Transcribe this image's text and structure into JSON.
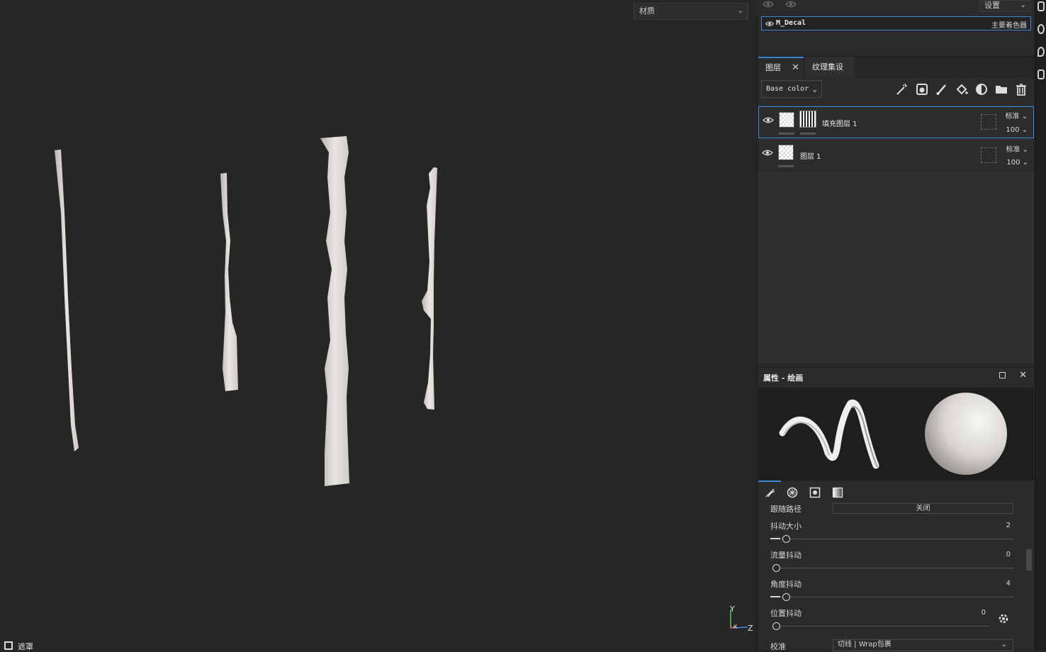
{
  "viewport": {
    "material_dropdown": "材质",
    "mask_toggle": "遮罩",
    "axis_labels": {
      "y": "Y",
      "x": "X",
      "z": "Z"
    }
  },
  "shader": {
    "settings_dropdown": "设置",
    "name": "M_Decal",
    "tag": "主要着色器"
  },
  "tabs": [
    {
      "label": "图层"
    },
    {
      "label": "纹理集设置"
    }
  ],
  "layers_toolbar": {
    "channel": "Base color"
  },
  "layers": [
    {
      "name": "填充图层 1",
      "blend": "标准",
      "opacity": "100"
    },
    {
      "name": "图层 1",
      "blend": "标准",
      "opacity": "100"
    }
  ],
  "properties": {
    "title": "属性 - 绘画",
    "follow_path_label": "跟随路径",
    "follow_path_value": "关闭",
    "params": [
      {
        "label": "抖动大小",
        "value": "2",
        "level": 0.04
      },
      {
        "label": "流量抖动",
        "value": "0",
        "level": 0.0
      },
      {
        "label": "角度抖动",
        "value": "4",
        "level": 0.04
      },
      {
        "label": "位置抖动",
        "value": "0",
        "level": 0.0
      }
    ],
    "alignment_label": "校准",
    "alignment_value": "切线 | Wrap包裹"
  },
  "colors": {
    "accent": "#3a87d6",
    "viewport_bg": "#262626",
    "panel_bg": "#2b2b2b"
  }
}
